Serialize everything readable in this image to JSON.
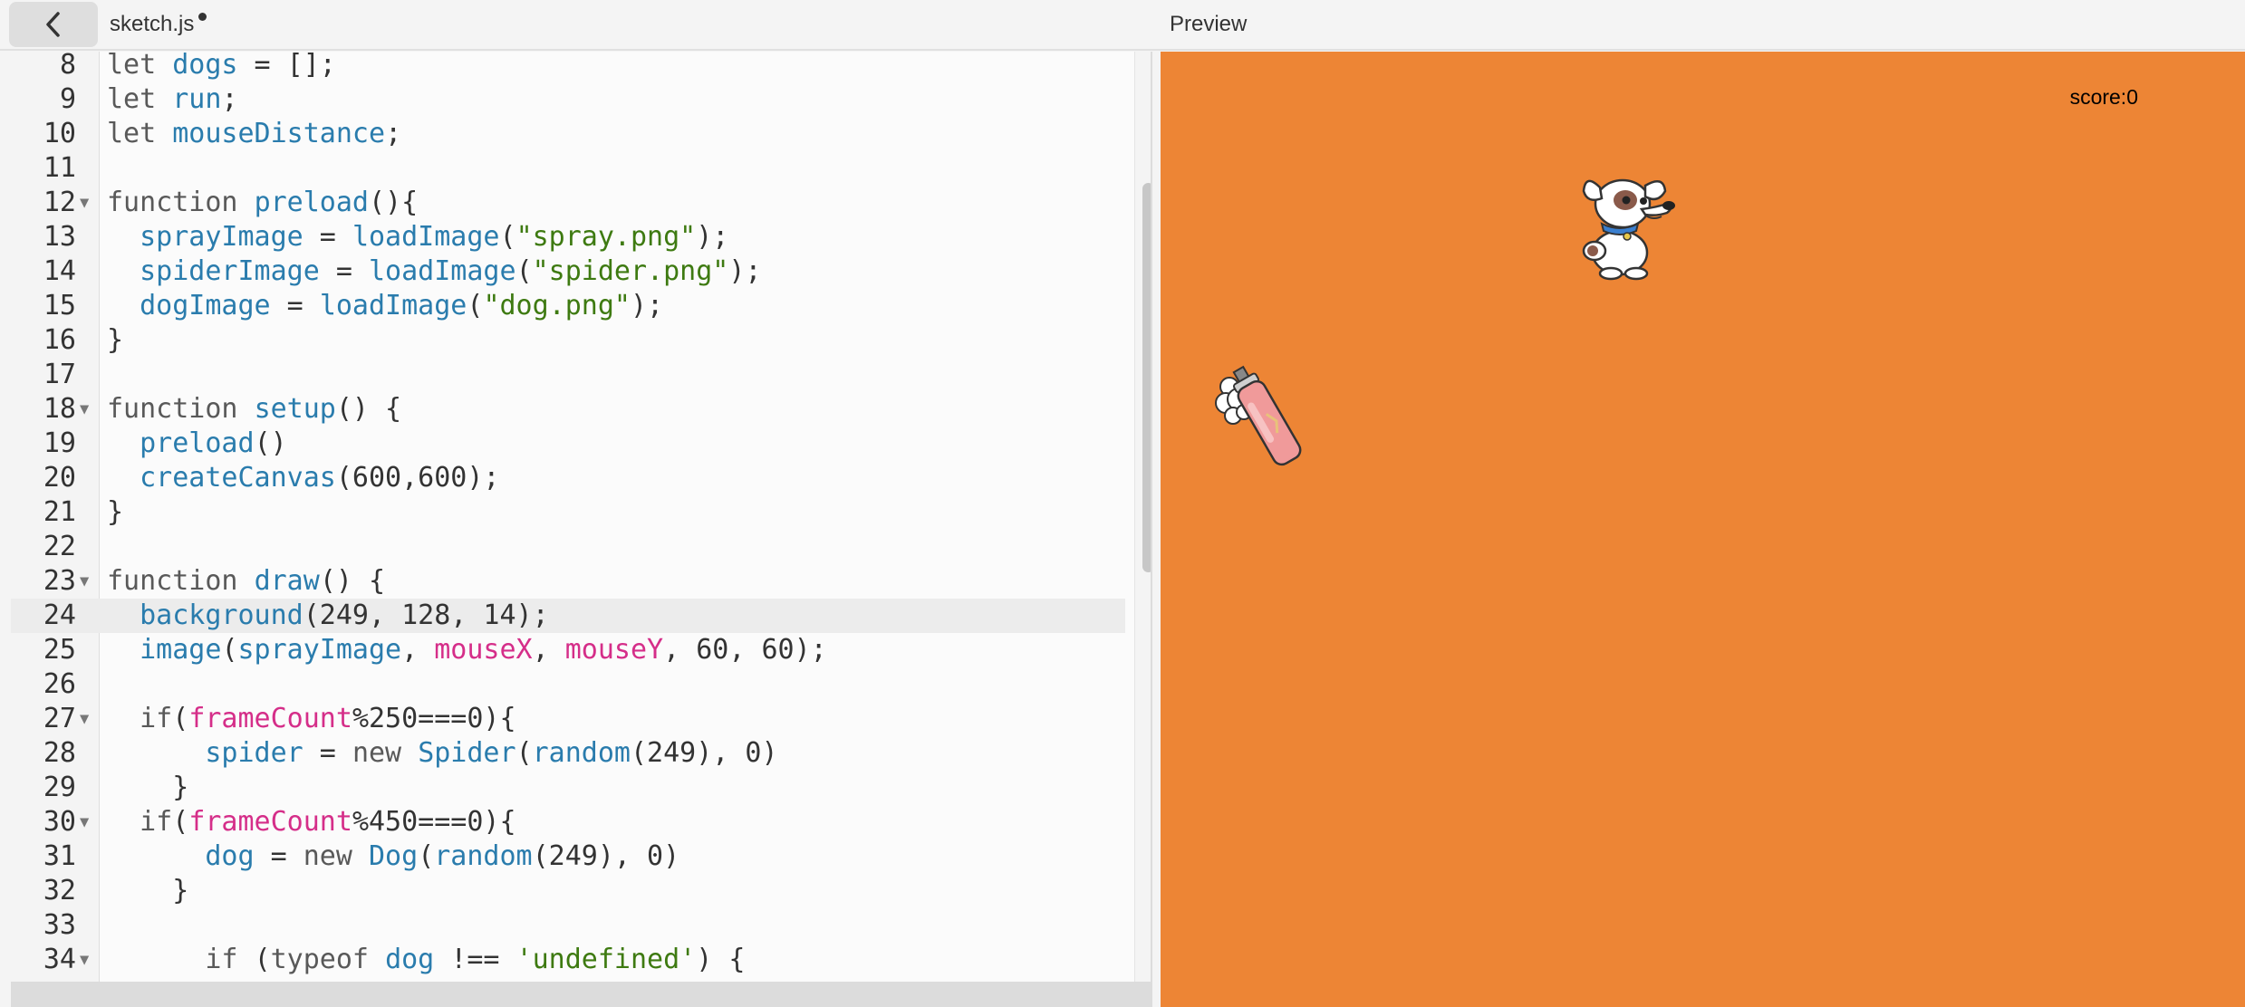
{
  "topbar": {
    "back_icon": "chevron-left-icon",
    "file_tab": "sketch.js",
    "preview_label": "Preview"
  },
  "editor": {
    "active_line": 24,
    "lines": [
      {
        "num": "8",
        "fold": false,
        "tokens": [
          [
            "kw",
            "let "
          ],
          [
            "fn",
            "dogs"
          ],
          [
            "p",
            " = [];"
          ]
        ]
      },
      {
        "num": "9",
        "fold": false,
        "tokens": [
          [
            "kw",
            "let "
          ],
          [
            "fn",
            "run"
          ],
          [
            "p",
            ";"
          ]
        ]
      },
      {
        "num": "10",
        "fold": false,
        "tokens": [
          [
            "kw",
            "let "
          ],
          [
            "fn",
            "mouseDistance"
          ],
          [
            "p",
            ";"
          ]
        ]
      },
      {
        "num": "11",
        "fold": false,
        "tokens": []
      },
      {
        "num": "12",
        "fold": true,
        "tokens": [
          [
            "kw",
            "function "
          ],
          [
            "fn",
            "preload"
          ],
          [
            "p",
            "(){"
          ]
        ]
      },
      {
        "num": "13",
        "fold": false,
        "tokens": [
          [
            "p",
            "  "
          ],
          [
            "fn",
            "sprayImage"
          ],
          [
            "p",
            " = "
          ],
          [
            "fn",
            "loadImage"
          ],
          [
            "p",
            "("
          ],
          [
            "str",
            "\"spray.png\""
          ],
          [
            "p",
            ");"
          ]
        ]
      },
      {
        "num": "14",
        "fold": false,
        "tokens": [
          [
            "p",
            "  "
          ],
          [
            "fn",
            "spiderImage"
          ],
          [
            "p",
            " = "
          ],
          [
            "fn",
            "loadImage"
          ],
          [
            "p",
            "("
          ],
          [
            "str",
            "\"spider.png\""
          ],
          [
            "p",
            ");"
          ]
        ]
      },
      {
        "num": "15",
        "fold": false,
        "tokens": [
          [
            "p",
            "  "
          ],
          [
            "fn",
            "dogImage"
          ],
          [
            "p",
            " = "
          ],
          [
            "fn",
            "loadImage"
          ],
          [
            "p",
            "("
          ],
          [
            "str",
            "\"dog.png\""
          ],
          [
            "p",
            ");"
          ]
        ]
      },
      {
        "num": "16",
        "fold": false,
        "tokens": [
          [
            "p",
            "}"
          ]
        ]
      },
      {
        "num": "17",
        "fold": false,
        "tokens": []
      },
      {
        "num": "18",
        "fold": true,
        "tokens": [
          [
            "kw",
            "function "
          ],
          [
            "fn",
            "setup"
          ],
          [
            "p",
            "() {"
          ]
        ]
      },
      {
        "num": "19",
        "fold": false,
        "tokens": [
          [
            "p",
            "  "
          ],
          [
            "fn",
            "preload"
          ],
          [
            "p",
            "()"
          ]
        ]
      },
      {
        "num": "20",
        "fold": false,
        "tokens": [
          [
            "p",
            "  "
          ],
          [
            "fn",
            "createCanvas"
          ],
          [
            "p",
            "(600,600);"
          ]
        ]
      },
      {
        "num": "21",
        "fold": false,
        "tokens": [
          [
            "p",
            "}"
          ]
        ]
      },
      {
        "num": "22",
        "fold": false,
        "tokens": []
      },
      {
        "num": "23",
        "fold": true,
        "tokens": [
          [
            "kw",
            "function "
          ],
          [
            "fn",
            "draw"
          ],
          [
            "p",
            "() {"
          ]
        ]
      },
      {
        "num": "24",
        "fold": false,
        "tokens": [
          [
            "p",
            "  "
          ],
          [
            "fn",
            "background"
          ],
          [
            "p",
            "(249, 128, 14);"
          ]
        ]
      },
      {
        "num": "25",
        "fold": false,
        "tokens": [
          [
            "p",
            "  "
          ],
          [
            "fn",
            "image"
          ],
          [
            "p",
            "("
          ],
          [
            "fn",
            "sprayImage"
          ],
          [
            "p",
            ", "
          ],
          [
            "var",
            "mouseX"
          ],
          [
            "p",
            ", "
          ],
          [
            "var",
            "mouseY"
          ],
          [
            "p",
            ", 60, 60);"
          ]
        ]
      },
      {
        "num": "26",
        "fold": false,
        "tokens": []
      },
      {
        "num": "27",
        "fold": true,
        "tokens": [
          [
            "p",
            "  "
          ],
          [
            "kw",
            "if"
          ],
          [
            "p",
            "("
          ],
          [
            "var",
            "frameCount"
          ],
          [
            "p",
            "%250===0){"
          ]
        ]
      },
      {
        "num": "28",
        "fold": false,
        "tokens": [
          [
            "p",
            "      "
          ],
          [
            "fn",
            "spider"
          ],
          [
            "p",
            " = "
          ],
          [
            "kw",
            "new "
          ],
          [
            "fn",
            "Spider"
          ],
          [
            "p",
            "("
          ],
          [
            "fn",
            "random"
          ],
          [
            "p",
            "(249), 0)"
          ]
        ]
      },
      {
        "num": "29",
        "fold": false,
        "tokens": [
          [
            "p",
            "    }"
          ]
        ]
      },
      {
        "num": "30",
        "fold": true,
        "tokens": [
          [
            "p",
            "  "
          ],
          [
            "kw",
            "if"
          ],
          [
            "p",
            "("
          ],
          [
            "var",
            "frameCount"
          ],
          [
            "p",
            "%450===0){"
          ]
        ]
      },
      {
        "num": "31",
        "fold": false,
        "tokens": [
          [
            "p",
            "      "
          ],
          [
            "fn",
            "dog"
          ],
          [
            "p",
            " = "
          ],
          [
            "kw",
            "new "
          ],
          [
            "fn",
            "Dog"
          ],
          [
            "p",
            "("
          ],
          [
            "fn",
            "random"
          ],
          [
            "p",
            "(249), 0)"
          ]
        ]
      },
      {
        "num": "32",
        "fold": false,
        "tokens": [
          [
            "p",
            "    }"
          ]
        ]
      },
      {
        "num": "33",
        "fold": false,
        "tokens": []
      },
      {
        "num": "34",
        "fold": true,
        "tokens": [
          [
            "p",
            "      "
          ],
          [
            "kw",
            "if "
          ],
          [
            "p",
            "("
          ],
          [
            "kw",
            "typeof "
          ],
          [
            "fn",
            "dog"
          ],
          [
            "p",
            " !== "
          ],
          [
            "str",
            "'undefined'"
          ],
          [
            "p",
            ") {"
          ]
        ]
      }
    ]
  },
  "preview": {
    "background": "#ed8535",
    "score_text": "score:0",
    "sprites": [
      "dog-sprite",
      "spray-bottle-sprite"
    ]
  }
}
